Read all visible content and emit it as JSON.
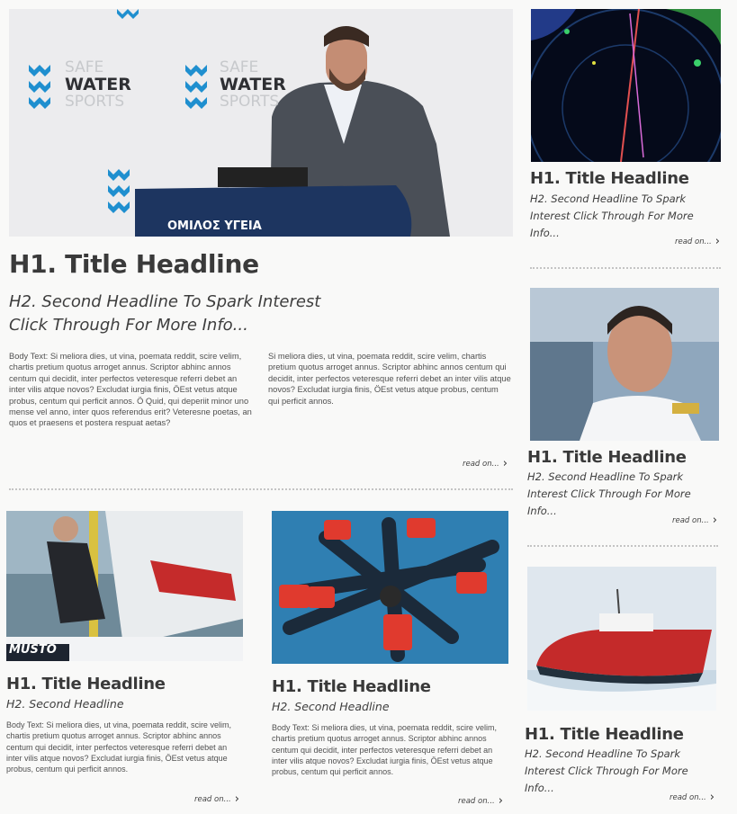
{
  "hero": {
    "banner_text": "ΟΜΙΛΟΣ ΥΓΕΙΑ",
    "backdrop_words": [
      "SAFE",
      "WATER",
      "SPORTS"
    ],
    "title": "H1. Title Headline",
    "subtitle_line1": "H2. Second Headline To Spark Interest",
    "subtitle_line2": "Click Through For More Info...",
    "body_col1": "Body Text: Si meliora dies, ut vina, poemata reddit, scire velim, chartis pretium quotus arroget annus. Scriptor abhinc annos centum qui decidit, inter perfectos veteresque referri debet an inter vilis atque novos? Excludat iurgia finis, ÖEst vetus atque probus, centum qui perficit annos. Ö Quid, qui deperiit minor uno mense vel anno, inter quos referendus erit? Veteresne poetas, an quos et praesens et postera respuat aetas?",
    "body_col2": "Si meliora dies, ut vina, poemata reddit, scire velim, chartis pretium quotus arroget annus. Scriptor abhinc annos centum qui decidit, inter perfectos veteresque referri debet an inter vilis atque novos? Excludat iurgia finis, ÖEst vetus atque probus, centum qui perficit annos.",
    "read_on": "read on..."
  },
  "cards": [
    {
      "title": "H1. Title Headline",
      "subtitle": "H2. Second Headline",
      "body": "Body Text: Si meliora dies, ut vina, poemata reddit, scire velim, chartis pretium quotus arroget annus. Scriptor abhinc annos centum qui decidit, inter perfectos veteresque referri debet an inter vilis atque novos? Excludat iurgia finis, ÖEst vetus atque probus, centum qui perficit annos.",
      "read_on": "read on...",
      "image_caption": "MUSTO"
    },
    {
      "title": "H1. Title Headline",
      "subtitle": "H2. Second Headline",
      "body": "Body Text: Si meliora dies, ut vina, poemata reddit, scire velim, chartis pretium quotus arroget annus. Scriptor abhinc annos centum qui decidit, inter perfectos veteresque referri debet an inter vilis atque novos? Excludat iurgia finis, ÖEst vetus atque probus, centum qui perficit annos.",
      "read_on": "read on..."
    }
  ],
  "sidebar": [
    {
      "title": "H1. Title Headline",
      "subtitle": "H2. Second Headline To Spark Interest Click Through For More Info...",
      "read_on": "read on..."
    },
    {
      "title": "H1. Title Headline",
      "subtitle": "H2. Second Headline To Spark Interest Click Through For More Info...",
      "read_on": "read on..."
    },
    {
      "title": "H1. Title Headline",
      "subtitle": "H2. Second Headline To Spark Interest Click Through For More Info...",
      "read_on": "read on..."
    }
  ],
  "colors": {
    "water_logo": "#1f8fcf",
    "podium": "#1d3560",
    "life_jacket": "#e03a2e"
  },
  "icons": [
    "chevron-right-icon",
    "safe-water-sports-logo-icon"
  ]
}
